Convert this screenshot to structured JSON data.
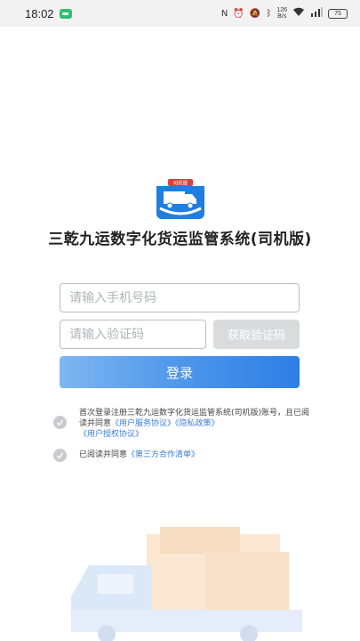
{
  "status_bar": {
    "time": "18:02",
    "net_speed_top": "126",
    "net_speed_bottom": "B/s",
    "battery": "75"
  },
  "app": {
    "logo_badge": "司机版",
    "title": "三乾九运数字化货运监管系统(司机版)"
  },
  "form": {
    "phone_placeholder": "请输入手机号码",
    "code_placeholder": "请输入验证码",
    "get_code_label": "获取验证码",
    "login_label": "登录"
  },
  "agreements": {
    "first_text_1": "首次登录注册三乾九运数字化货运监管系统(司机版)账号，且已阅读并同意",
    "service_link": "《用户服务协议》",
    "privacy_link": "《隐私政策》",
    "auth_link": "《用户授权协议》",
    "second_text": "已阅读并同意",
    "third_party_link": "《第三方合作清单》"
  },
  "colors": {
    "accent": "#2d7ee6",
    "link": "#3b7fd9"
  }
}
